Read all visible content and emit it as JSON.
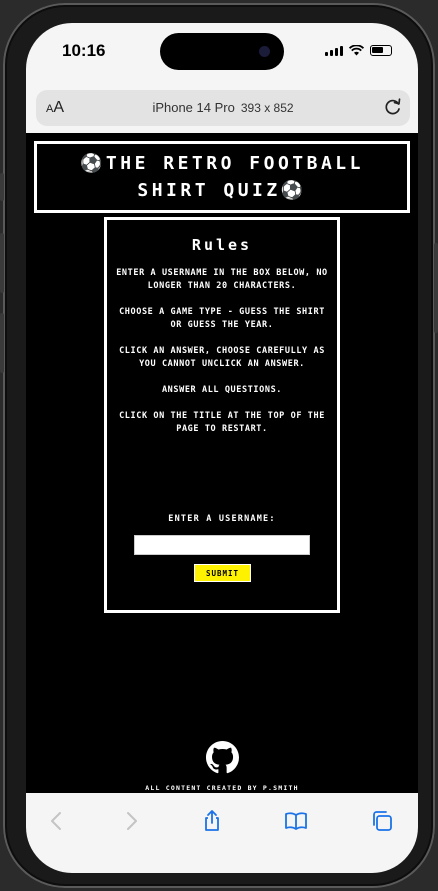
{
  "status": {
    "time": "10:16"
  },
  "browser": {
    "text_size_label": "AA",
    "device_name": "iPhone 14 Pro",
    "dimensions": "393 x 852"
  },
  "page": {
    "title": "⚽The Retro Football Shirt Quiz⚽",
    "rules_heading": "Rules",
    "rules": [
      "Enter a username in the box below, no longer than 20 characters.",
      "Choose a game type - guess the shirt or guess the year.",
      "Click an answer, choose carefully as you cannot unclick an answer.",
      "Answer all questions.",
      "Click on the title at the top of the page to restart."
    ],
    "username_label": "Enter a username:",
    "username_value": "",
    "submit_label": "Submit",
    "footer_credit": "All content created by P.Smith"
  },
  "toolbar": {
    "icons": [
      "back-icon",
      "forward-icon",
      "share-icon",
      "bookmarks-icon",
      "tabs-icon"
    ]
  },
  "colors": {
    "page_background": "#000000",
    "border": "#ffffff",
    "submit_button": "#fff200",
    "chrome": "#f5f5f5"
  }
}
